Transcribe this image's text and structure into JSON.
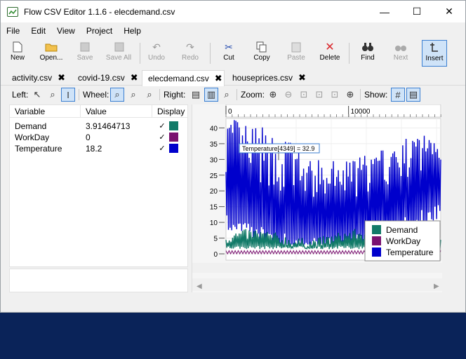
{
  "window": {
    "title": "Flow CSV Editor 1.1.6 - elecdemand.csv",
    "minimize": "—",
    "maximize": "☐",
    "close": "✕"
  },
  "menu": [
    "File",
    "Edit",
    "View",
    "Project",
    "Help"
  ],
  "toolbar": {
    "new": "New",
    "open": "Open...",
    "save": "Save",
    "save_all": "Save All",
    "undo": "Undo",
    "redo": "Redo",
    "cut": "Cut",
    "copy": "Copy",
    "paste": "Paste",
    "delete": "Delete",
    "find": "Find",
    "next": "Next",
    "insert": "Insert"
  },
  "tabs": [
    {
      "label": "activity.csv",
      "close": "✖"
    },
    {
      "label": "covid-19.csv",
      "close": "✖"
    },
    {
      "label": "elecdemand.csv",
      "close": "✖"
    },
    {
      "label": "houseprices.csv",
      "close": "✖"
    }
  ],
  "controls": {
    "left": "Left:",
    "wheel": "Wheel:",
    "right": "Right:",
    "zoom": "Zoom:",
    "show": "Show:"
  },
  "variables": {
    "headers": [
      "Variable",
      "Value",
      "Display"
    ],
    "rows": [
      {
        "name": "Demand",
        "value": "3.91464713",
        "check": "✓",
        "color": "#127a68"
      },
      {
        "name": "WorkDay",
        "value": "0",
        "check": "✓",
        "color": "#7a1270"
      },
      {
        "name": "Temperature",
        "value": "18.2",
        "check": "✓",
        "color": "#0000cc"
      }
    ]
  },
  "chart_data": {
    "type": "line",
    "x_ticks": [
      "0",
      "10000"
    ],
    "xlim": [
      0,
      17520
    ],
    "ylim": [
      -2,
      43
    ],
    "y_ticks": [
      0,
      5,
      10,
      15,
      20,
      25,
      30,
      35,
      40
    ],
    "tooltip": "Temperature[4349] = 32.9",
    "series": [
      {
        "name": "Demand",
        "color": "#127a68",
        "range": [
          1.5,
          9
        ]
      },
      {
        "name": "WorkDay",
        "color": "#7a1270",
        "range": [
          0,
          1
        ]
      },
      {
        "name": "Temperature",
        "color": "#0000cc",
        "range": [
          3,
          43
        ]
      }
    ],
    "legend_position": "bottom-right"
  }
}
